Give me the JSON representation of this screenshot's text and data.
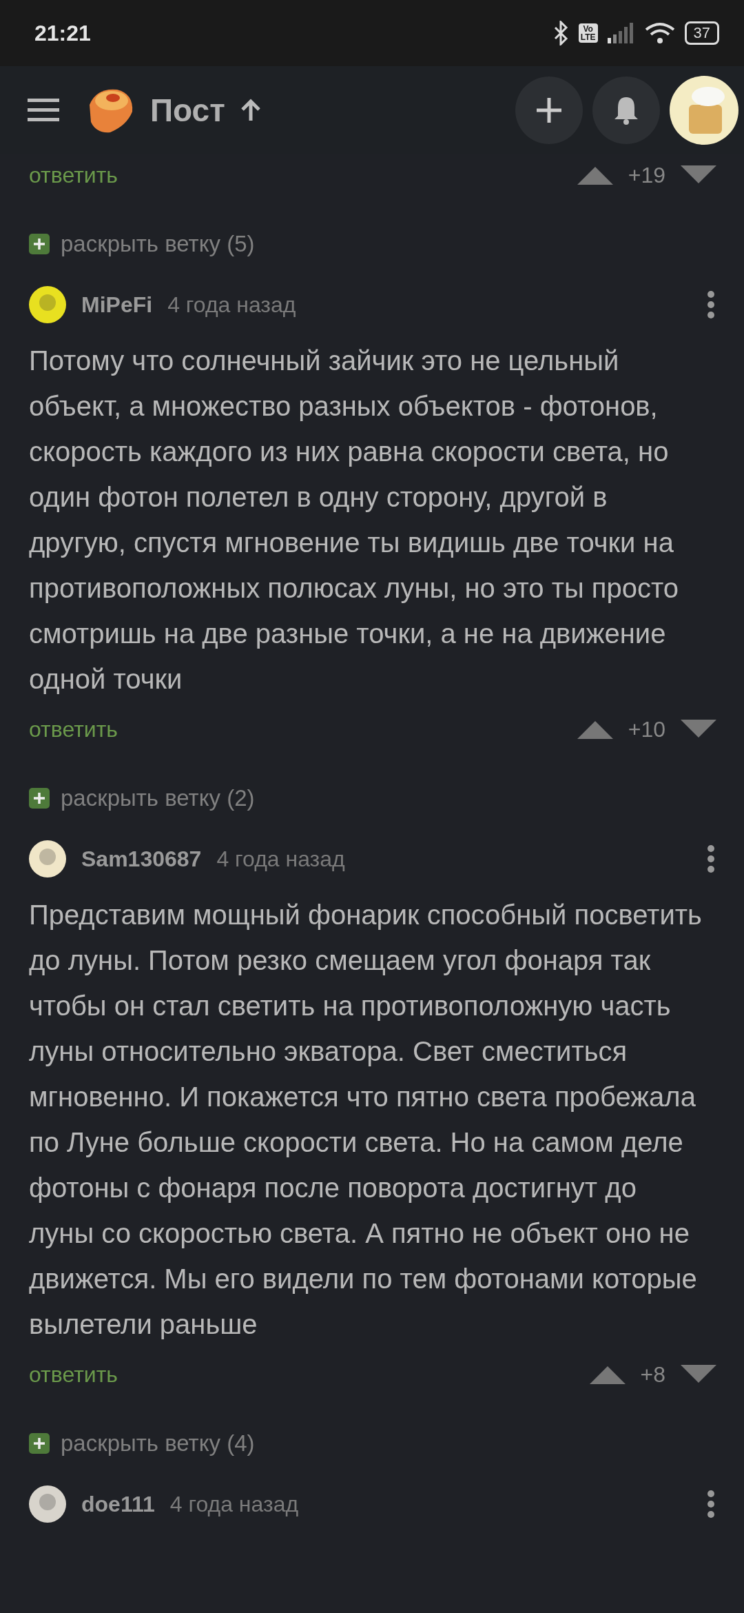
{
  "status_bar": {
    "time": "21:21",
    "volte_top": "Vo",
    "volte_bottom": "LTE",
    "battery": "37"
  },
  "header": {
    "title": "Пост"
  },
  "top_reply": {
    "reply": "ответить",
    "score": "+19"
  },
  "comments": [
    {
      "expand": "раскрыть ветку (5)",
      "author": "MiPeFi",
      "time": "4 года назад",
      "text": "Потому что солнечный зайчик это не цельный объект, а множество разных объектов - фотонов, скорость каждого из них равна скорости света, но один фотон полетел в одну сторону, другой в другую, спустя мгновение ты видишь две точки на противоположных полюсах луны, но это ты просто смотришь на две разные точки, а не на движение одной точки",
      "reply": "ответить",
      "score": "+10"
    },
    {
      "expand": "раскрыть ветку (2)",
      "author": "Sam130687",
      "time": "4 года назад",
      "text": "Представим мощный фонарик способный посветить до луны. Потом резко смещаем угол фонаря так чтобы он стал светить на противоположную часть луны относительно экватора. Свет сместиться мгновенно. И покажется что пятно света пробежала по Луне больше скорости света. Но на самом деле фотоны с фонаря после поворота достигнут до луны со скоростью света. А пятно не объект оно не движется. Мы его видели по тем фотонами которые вылетели раньше",
      "reply": "ответить",
      "score": "+8"
    },
    {
      "expand": "раскрыть ветку (4)",
      "author": "doe111",
      "time": "4 года назад"
    }
  ]
}
